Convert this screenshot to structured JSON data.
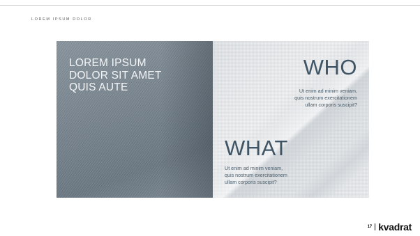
{
  "slide": {
    "eyebrow": "LOREM IPSUM DOLOR",
    "left_panel": {
      "headline": "LOREM IPSUM\nDOLOR SIT AMET\nQUIS AUTE"
    },
    "who": {
      "title": "WHO",
      "body": "Ut enim ad minim veniam,\nquis nostrum exercitationem\nullam corporis suscipit?"
    },
    "what": {
      "title": "WHAT",
      "body": "Ut enim ad minim veniam,\nquis nostrum exercitationem\nullam corporis suscipit?"
    },
    "footer": {
      "page_number": "17",
      "brand": "kvadrat"
    }
  },
  "colors": {
    "accent_text": "#3f5565",
    "left_panel": "#7a8791",
    "right_panel": "#e9ecee"
  }
}
